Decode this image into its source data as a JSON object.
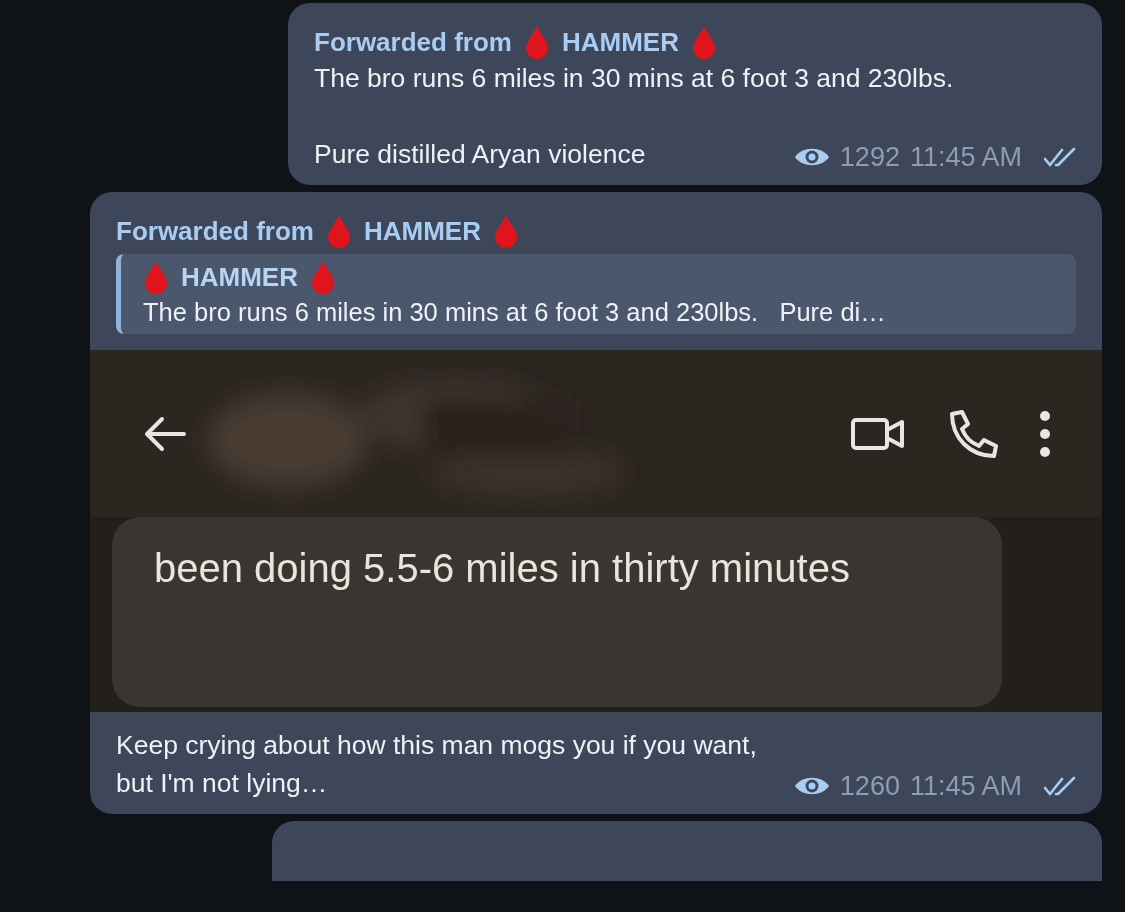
{
  "messages": [
    {
      "kind": "full",
      "forwarded_label": "Forwarded from",
      "source": "HAMMER",
      "paragraphs": [
        "The bro runs 6 miles in 30 mins at 6 foot 3 and 230lbs.",
        "Pure distilled Aryan violence"
      ],
      "views": "1292",
      "time": "11:45 AM",
      "read": true
    },
    {
      "kind": "full",
      "forwarded_label": "Forwarded from",
      "source": "HAMMER",
      "reply": {
        "source": "HAMMER",
        "preview": "The bro runs 6 miles in 30 mins at 6 foot 3 and 230lbs.   Pure di…"
      },
      "screenshot": {
        "chat_text": "been doing 5.5-6 miles in thirty minutes"
      },
      "paragraphs": [
        "Keep crying about how this man mogs you if you want, but I'm not lying…"
      ],
      "views": "1260",
      "time": "11:45 AM",
      "read": true
    },
    {
      "kind": "partial"
    }
  ]
}
